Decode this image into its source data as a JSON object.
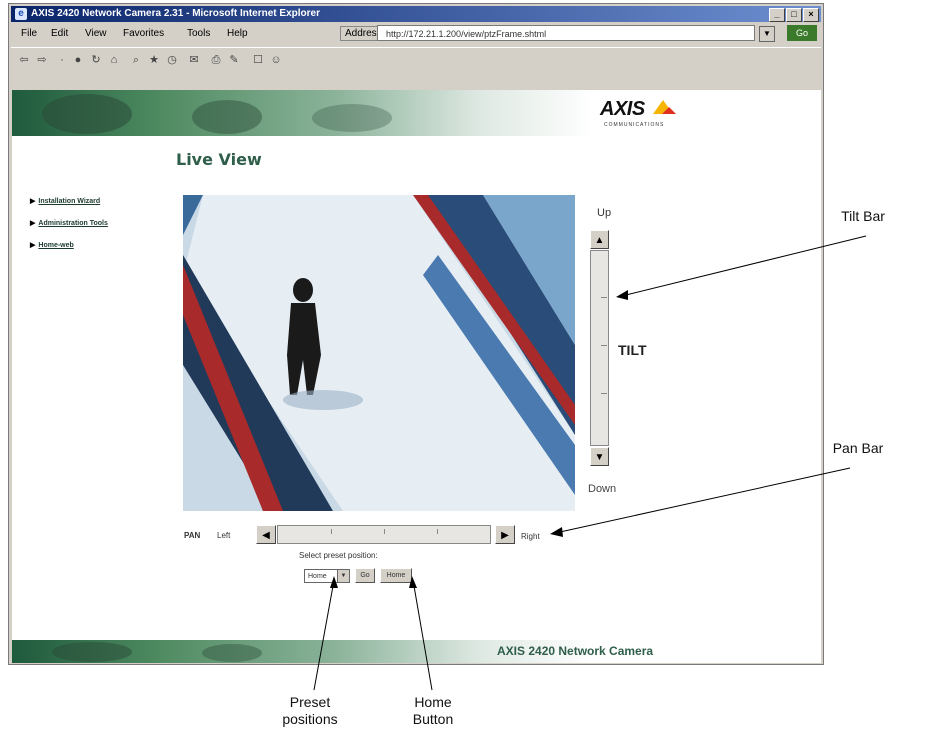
{
  "window": {
    "title": "AXIS 2420 Network Camera 2.31 - Microsoft Internet Explorer",
    "controls": [
      "_",
      "□",
      "×"
    ]
  },
  "menubar": {
    "items": [
      "File",
      "Edit",
      "View",
      "Favorites",
      "Tools",
      "Help"
    ],
    "address_label": "Address",
    "address_value": "http://172.21.1.200/view/ptzFrame.shtml",
    "go_label": "Go"
  },
  "page": {
    "title": "Live View",
    "nav": [
      "Installation Wizard",
      "Administration Tools",
      "Home-web"
    ],
    "logo_text": "AXIS",
    "logo_sub": "COMMUNICATIONS",
    "footer_text": "AXIS 2420 Network Camera"
  },
  "tilt": {
    "up_label": "Up",
    "down_label": "Down",
    "bar_label": "TILT",
    "up_arrow": "▲",
    "down_arrow": "▼"
  },
  "pan": {
    "label": "PAN",
    "left_label": "Left",
    "right_label": "Right",
    "left_arrow": "◀",
    "right_arrow": "▶"
  },
  "preset": {
    "label": "Select preset position:",
    "selected": "Home",
    "go_label": "Go",
    "home_label": "Home"
  },
  "callouts": {
    "tilt_bar": "Tilt Bar",
    "pan_bar": "Pan Bar",
    "preset_line1": "Preset",
    "preset_line2": "positions",
    "home_line1": "Home",
    "home_line2": "Button"
  }
}
